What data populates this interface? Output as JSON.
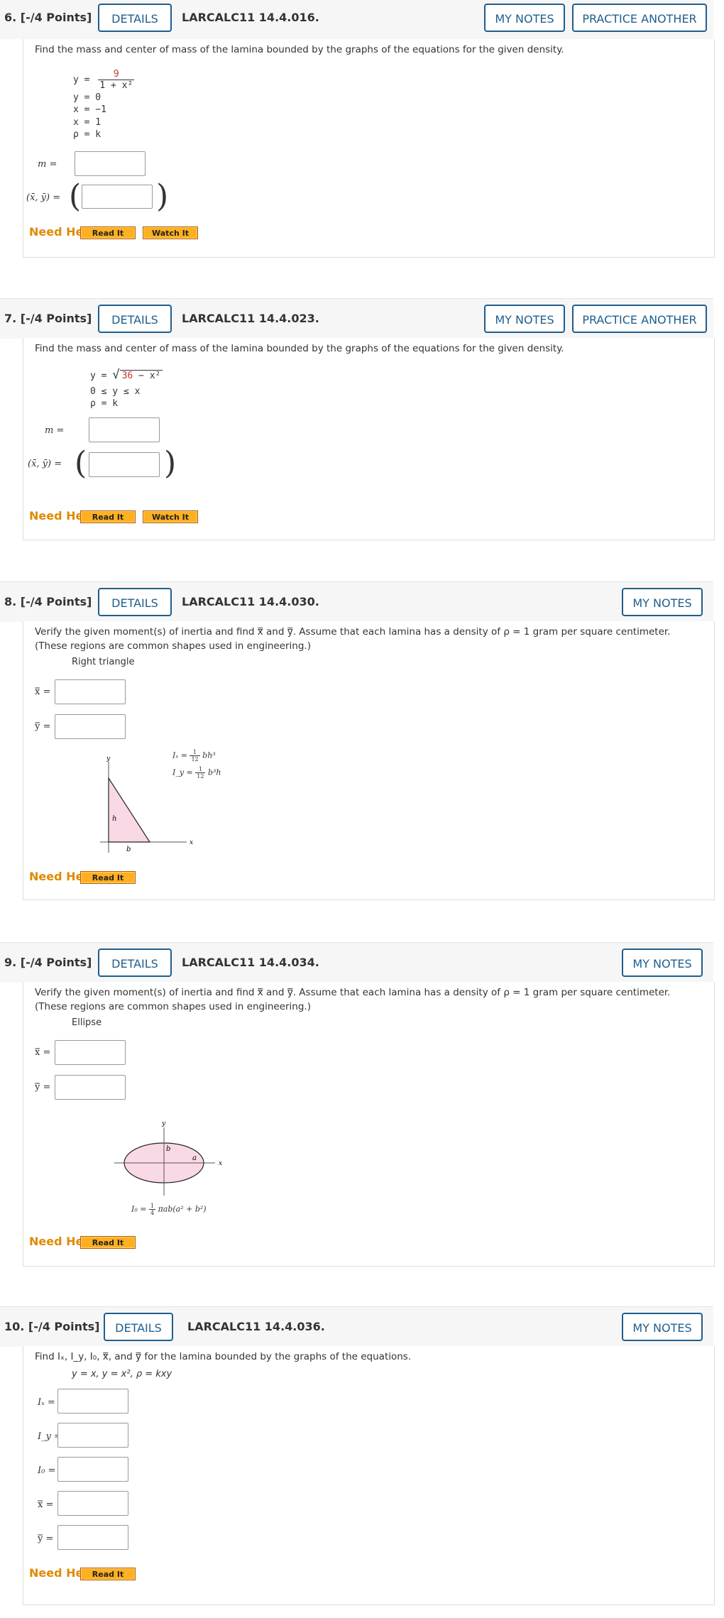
{
  "buttons": {
    "details": "DETAILS",
    "my_notes": "MY NOTES",
    "practice_another": "PRACTICE ANOTHER",
    "need_help": "Need Help?",
    "read_it": "Read It",
    "watch_it": "Watch It"
  },
  "q6": {
    "number": "6.  [-/4 Points]",
    "code": "LARCALC11 14.4.016.",
    "instruction": "Find the mass and center of mass of the lamina bounded by the graphs of the equations for the given density.",
    "y_lhs": "y =",
    "frac_num": "9",
    "frac_den": "1 + x²",
    "eq2": "y = 0",
    "eq3": "x = −1",
    "eq4": "x = 1",
    "eq5": "ρ = k",
    "m_label": "m =",
    "center_label": "(x̄, ȳ) ="
  },
  "q7": {
    "number": "7.  [-/4 Points]",
    "code": "LARCALC11 14.4.023.",
    "instruction": "Find the mass and center of mass of the lamina bounded by the graphs of the equations for the given density.",
    "y_lhs": "y =",
    "sqrt_red": "36",
    "sqrt_rest": " − x²",
    "eq2": "0 ≤ y ≤ x",
    "eq3": "ρ = k",
    "m_label": "m =",
    "center_label": "(x̄, ȳ) ="
  },
  "q8": {
    "number": "8.  [-/4 Points]",
    "code": "LARCALC11 14.4.030.",
    "instruction": "Verify the given moment(s) of inertia and find x̿ and y̿. Assume that each lamina has a density of ρ = 1 gram per square centimeter. (These regions are common shapes used in engineering.)",
    "shape": "Right triangle",
    "xbar_label": "x̿ =",
    "ybar_label": "y̿ =",
    "fig_ix": "Iₓ = ",
    "fig_ix_rest": "bh³",
    "fig_iy": "I_y = ",
    "fig_iy_rest": "b³h",
    "fig_frac_n": "1",
    "fig_frac_d": "12",
    "axis_x": "x",
    "axis_y": "y",
    "label_h": "h",
    "label_b": "b"
  },
  "q9": {
    "number": "9.  [-/4 Points]",
    "code": "LARCALC11 14.4.034.",
    "instruction": "Verify the given moment(s) of inertia and find x̿ and y̿. Assume that each lamina has a density of ρ = 1 gram per square centimeter. (These regions are common shapes used in engineering.)",
    "shape": "Ellipse",
    "xbar_label": "x̿ =",
    "ybar_label": "y̿ =",
    "fig_i0": "I₀ = ",
    "fig_frac_n": "1",
    "fig_frac_d": "4",
    "fig_i0_rest": "πab(a² + b²)",
    "axis_x": "x",
    "axis_y": "y",
    "label_a": "a",
    "label_b": "b"
  },
  "q10": {
    "number": "10.  [-/4 Points]",
    "code": "LARCALC11 14.4.036.",
    "instruction": "Find Iₓ, I_y, I₀, x̿, and y̿ for the lamina bounded by the graphs of the equations.",
    "equations": "y = x,  y = x²,  ρ = kxy",
    "ix_label": "Iₓ =",
    "iy_label": "I_y =",
    "i0_label": "I₀ =",
    "xbar_label": "x̿ =",
    "ybar_label": "y̿ ="
  },
  "colors": {
    "accent": "#1f5e8d",
    "help": "#e08a00",
    "button_fill": "#ffb020",
    "red_text": "#c0392b",
    "figure_fill": "#f9d9e6"
  }
}
